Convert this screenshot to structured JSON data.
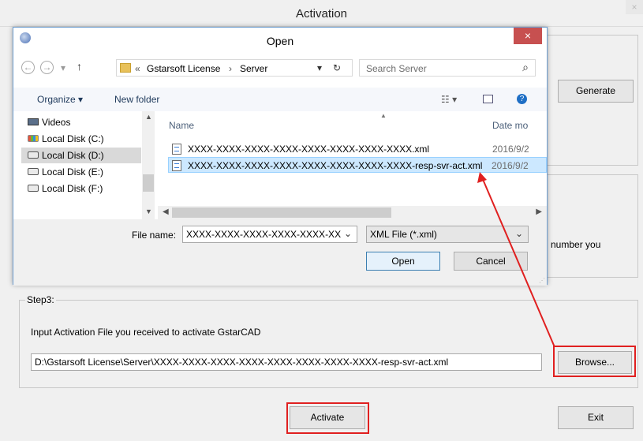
{
  "activation_window": {
    "title": "Activation",
    "close_label": "×",
    "generate_label": "Generate",
    "step2_partial_text": "number you",
    "step3": {
      "legend": "Step3:",
      "instruction": "Input Activation File you received to activate GstarCAD",
      "file_path": "D:\\Gstarsoft License\\Server\\XXXX-XXXX-XXXX-XXXX-XXXX-XXXX-XXXX-XXXX-resp-svr-act.xml",
      "browse_label": "Browse..."
    },
    "activate_label": "Activate",
    "exit_label": "Exit"
  },
  "open_dialog": {
    "title": "Open",
    "close_label": "×",
    "nav": {
      "back": "←",
      "forward": "→",
      "dropdown": "▾",
      "up": "↑",
      "breadcrumb_prefix": "«",
      "breadcrumb": [
        "Gstarsoft License",
        "Server"
      ],
      "breadcrumb_sep": "›",
      "refresh": "↻",
      "search_placeholder": "Search Server",
      "search_icon": "⌕"
    },
    "toolbar": {
      "organize": "Organize ▾",
      "new_folder": "New folder",
      "view_icon": "☷ ▾",
      "help": "?"
    },
    "nav_pane": {
      "items": [
        {
          "label": "Videos",
          "icon": "videos-icon"
        },
        {
          "label": "Local Disk (C:)",
          "icon": "system-drive-icon"
        },
        {
          "label": "Local Disk (D:)",
          "icon": "drive-icon",
          "selected": true
        },
        {
          "label": "Local Disk (E:)",
          "icon": "drive-icon"
        },
        {
          "label": "Local Disk (F:)",
          "icon": "drive-icon"
        }
      ]
    },
    "columns": {
      "name": "Name",
      "date": "Date mo"
    },
    "files": [
      {
        "name": "XXXX-XXXX-XXXX-XXXX-XXXX-XXXX-XXXX-XXXX.xml",
        "date": "2016/9/2",
        "selected": false
      },
      {
        "name": "XXXX-XXXX-XXXX-XXXX-XXXX-XXXX-XXXX-XXXX-resp-svr-act.xml",
        "date": "2016/9/2",
        "selected": true
      }
    ],
    "file_name_label": "File name:",
    "file_name_value": "XXXX-XXXX-XXXX-XXXX-XXXX-XX",
    "file_type_value": "XML File (*.xml)",
    "open_label": "Open",
    "cancel_label": "Cancel"
  },
  "colors": {
    "highlight_box": "#e02020",
    "arrow": "#e02020",
    "selected_row": "#cce8ff"
  }
}
